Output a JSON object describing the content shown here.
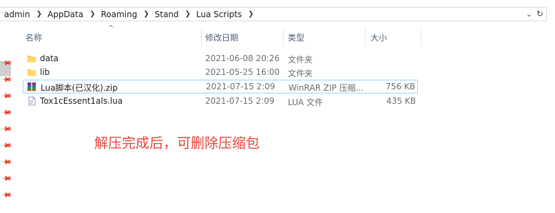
{
  "breadcrumb": [
    "admin",
    "AppData",
    "Roaming",
    "Stand",
    "Lua Scripts"
  ],
  "columns": {
    "name": "名称",
    "modified": "修改日期",
    "type": "类型",
    "size": "大小"
  },
  "files": [
    {
      "name": "data",
      "modified": "2021-06-08 20:26",
      "type": "文件夹",
      "size": "",
      "icon": "folder-icon"
    },
    {
      "name": "lib",
      "modified": "2021-05-25 16:00",
      "type": "文件夹",
      "size": "",
      "icon": "folder-icon"
    },
    {
      "name": "Lua脚本(已汉化).zip",
      "modified": "2021-07-15 2:09",
      "type": "WinRAR ZIP 压缩...",
      "size": "756 KB",
      "icon": "winrar-archive-icon"
    },
    {
      "name": "Tox1cEssent1als.lua",
      "modified": "2021-07-15 2:09",
      "type": "LUA 文件",
      "size": "435 KB",
      "icon": "lua-file-icon"
    }
  ],
  "annotation": "解压完成后，可删除压缩包",
  "colors": {
    "annotation": "#e8433a",
    "header_text": "#4c607a",
    "selection_border": "#99d1ff"
  }
}
